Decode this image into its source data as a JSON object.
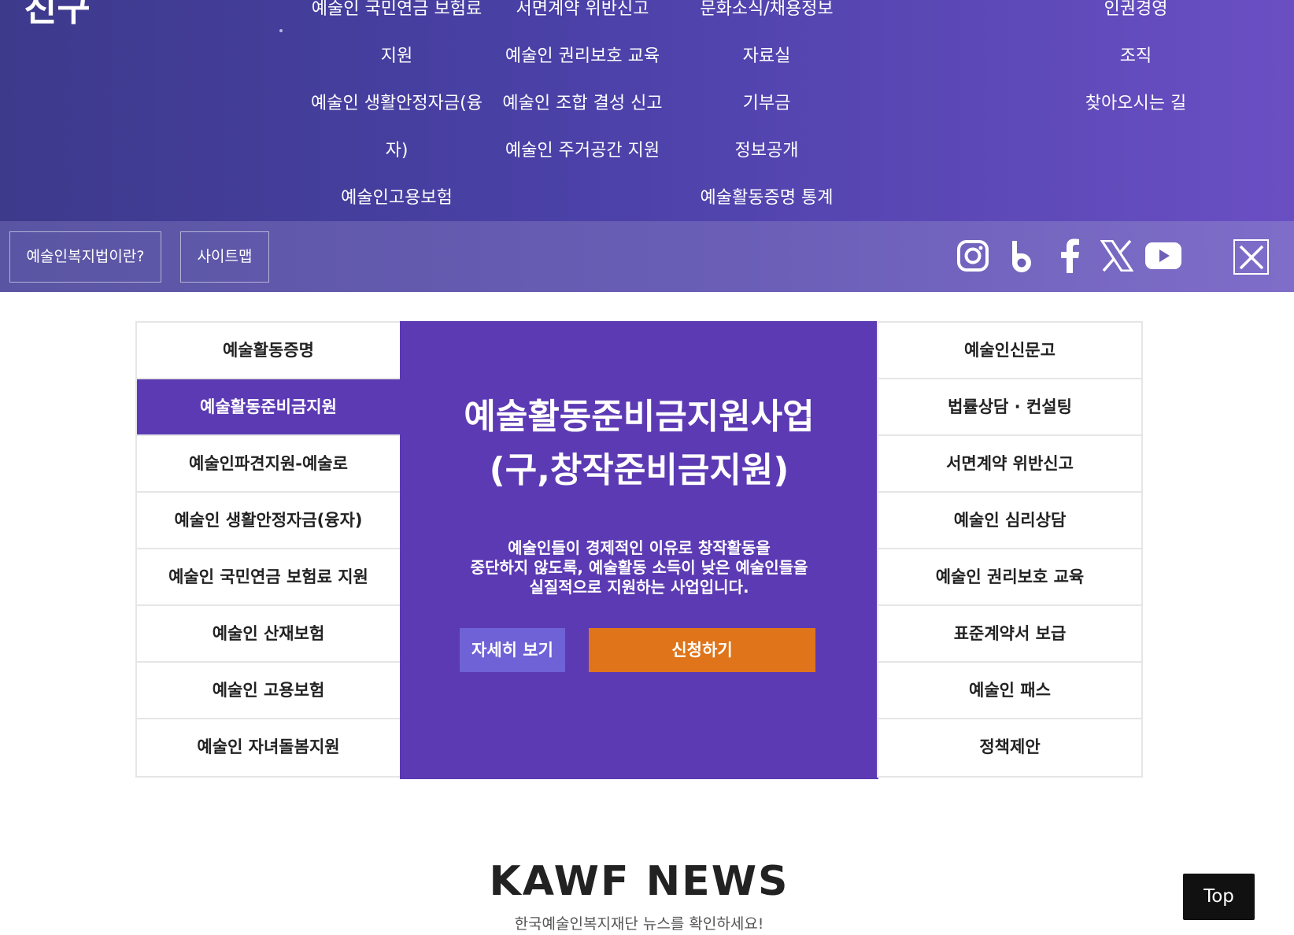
{
  "megamenu": {
    "logo_partial": "친구",
    "col1": [
      "예술인 국민연금 보험료",
      "지원",
      "예술인 생활안정자금(융",
      "자)",
      "예술인고용보험"
    ],
    "col2": [
      "서면계약 위반신고",
      "예술인 권리보호 교육",
      "예술인 조합 결성 신고",
      "예술인 주거공간 지원"
    ],
    "col3": [
      "문화소식/채용정보",
      "자료실",
      "기부금",
      "정보공개",
      "예술활동증명 통계"
    ],
    "col4": [
      "인권경영",
      "조직",
      "찾아오시는 길"
    ]
  },
  "utilbar": {
    "about_label": "예술인복지법이란?",
    "sitemap_label": "사이트맵"
  },
  "programs": {
    "left": [
      "예술활동증명",
      "예술활동준비금지원",
      "예술인파견지원-예술로",
      "예술인 생활안정자금(융자)",
      "예술인 국민연금 보험료 지원",
      "예술인 산재보험",
      "예술인 고용보험",
      "예술인 자녀돌봄지원"
    ],
    "right": [
      "예술인신문고",
      "법률상담 · 컨설팅",
      "서면계약 위반신고",
      "예술인 심리상담",
      "예술인 권리보호 교육",
      "표준계약서 보급",
      "예술인 패스",
      "정책제안"
    ],
    "active_index": 1,
    "active_color": "#5c3ab4"
  },
  "feature": {
    "title_line1": "예술활동준비금지원사업",
    "title_line2": "(구,창작준비금지원)",
    "desc_line1": "예술인들이 경제적인 이유로 창작활동을",
    "desc_line2": "중단하지 않도록, 예술활동 소득이 낮은 예술인들을",
    "desc_line3": "실질적으로 지원하는 사업입니다.",
    "more_label": "자세히 보기",
    "apply_label": "신청하기",
    "apply_color": "#e0741a"
  },
  "news": {
    "title": "KAWF NEWS",
    "subtitle": "한국예술인복지재단 뉴스를 확인하세요!"
  },
  "top_label": "Top"
}
